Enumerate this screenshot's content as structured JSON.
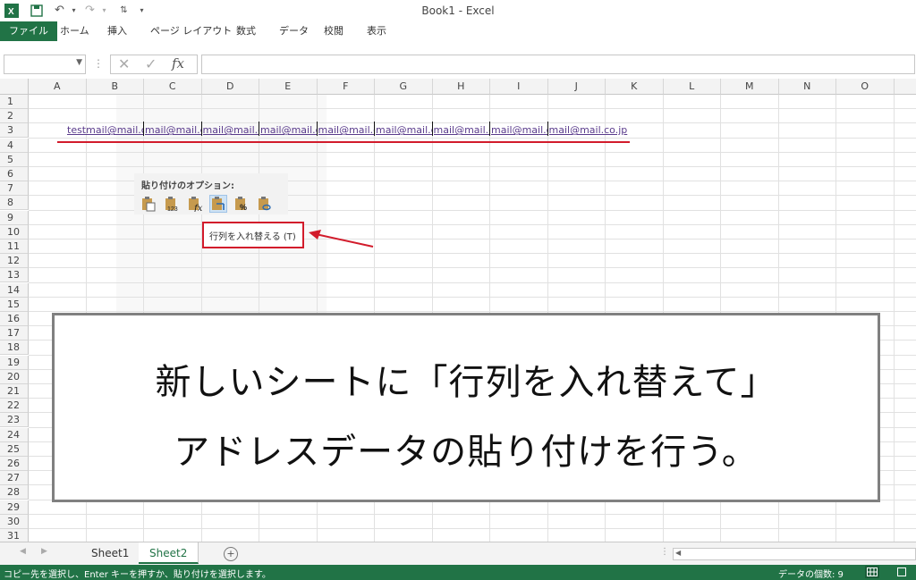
{
  "window": {
    "title": "Book1 - Excel"
  },
  "ribbon": {
    "tabs": [
      {
        "label": "ファイル",
        "active": true
      },
      {
        "label": "ホーム"
      },
      {
        "label": "挿入"
      },
      {
        "label": "ページ レイアウト"
      },
      {
        "label": "数式"
      },
      {
        "label": "データ"
      },
      {
        "label": "校閲"
      },
      {
        "label": "表示"
      }
    ]
  },
  "formula_bar": {
    "name_box": "",
    "fx": "fx",
    "value": ""
  },
  "grid": {
    "columns": [
      "A",
      "B",
      "C",
      "D",
      "E",
      "F",
      "G",
      "H",
      "I",
      "J",
      "K",
      "L",
      "M",
      "N",
      "O"
    ],
    "rows": [
      "1",
      "2",
      "3",
      "4",
      "5",
      "6",
      "7",
      "8",
      "9",
      "10",
      "11",
      "12",
      "13",
      "14",
      "15",
      "16",
      "17",
      "18",
      "19",
      "20",
      "21",
      "22",
      "23",
      "24",
      "25",
      "26",
      "27",
      "28",
      "29",
      "30",
      "31"
    ],
    "row3_cells": [
      "testmail@mail.co.jp",
      "mail@mail.co.jp",
      "mail@mail.co.jp",
      "mail@mail.co.jp",
      "mail@mail.co.jp",
      "mail@mail.co.jp",
      "mail@mail.co.jp",
      "mail@mail.co.jp",
      "mail@mail.co.jp"
    ],
    "accent_color": "#d21b2b"
  },
  "paste_options": {
    "title": "貼り付けのオプション:",
    "icons": [
      "paste-icon",
      "paste-values-icon",
      "paste-formulas-icon",
      "paste-transpose-icon",
      "paste-formatting-icon",
      "paste-link-icon"
    ],
    "tooltip": "行列を入れ替える (T)"
  },
  "overlay": {
    "line1": "新しいシートに「行列を入れ替えて」",
    "line2": "アドレスデータの貼り付けを行う。"
  },
  "sheets": [
    {
      "label": "Sheet1"
    },
    {
      "label": "Sheet2",
      "active": true
    }
  ],
  "status": {
    "message": "コピー先を選択し、Enter キーを押すか、貼り付けを選択します。",
    "count": "データの個数: 9"
  },
  "colors": {
    "excel_green": "#217346",
    "arrow_red": "#d21b2b"
  }
}
